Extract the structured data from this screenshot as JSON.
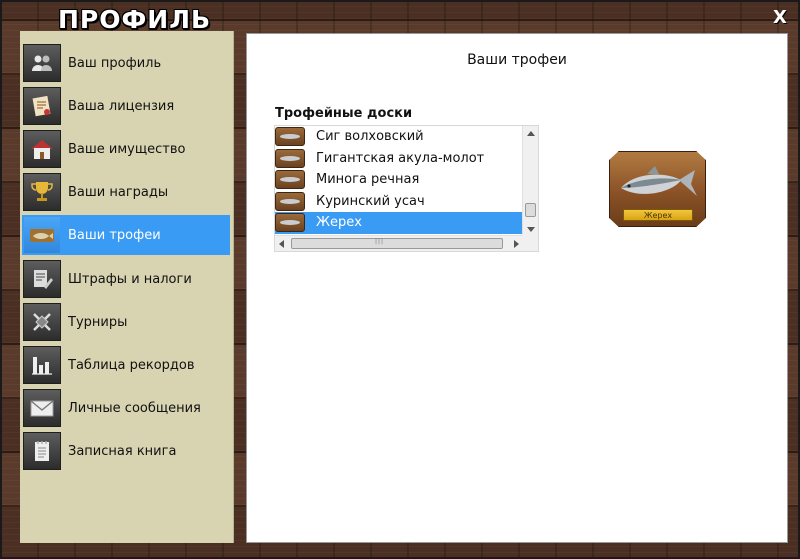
{
  "window": {
    "title": "ПРОФИЛЬ",
    "close_label": "X"
  },
  "sidebar": {
    "items": [
      {
        "label": "Ваш профиль",
        "icon": "users-icon",
        "active": false
      },
      {
        "label": "Ваша лицензия",
        "icon": "license-icon",
        "active": false
      },
      {
        "label": "Ваше имущество",
        "icon": "house-icon",
        "active": false
      },
      {
        "label": "Ваши награды",
        "icon": "trophy-cup-icon",
        "active": false
      },
      {
        "label": "Ваши трофеи",
        "icon": "fish-trophy-icon",
        "active": true
      },
      {
        "label": "Штрафы и налоги",
        "icon": "document-pen-icon",
        "active": false
      },
      {
        "label": "Турниры",
        "icon": "crossed-swords-icon",
        "active": false
      },
      {
        "label": "Таблица рекордов",
        "icon": "bar-chart-icon",
        "active": false
      },
      {
        "label": "Личные сообщения",
        "icon": "envelope-icon",
        "active": false
      },
      {
        "label": "Записная книга",
        "icon": "notebook-icon",
        "active": false
      }
    ]
  },
  "main": {
    "title": "Ваши трофеи",
    "section_label": "Трофейные доски",
    "trophy_list": [
      {
        "name": "Сиг волховский",
        "selected": false
      },
      {
        "name": "Гигантская акула-молот",
        "selected": false
      },
      {
        "name": "Минога речная",
        "selected": false
      },
      {
        "name": "Куринский усач",
        "selected": false
      },
      {
        "name": "Жерех",
        "selected": true
      }
    ],
    "preview": {
      "plaque_label": "Жерех"
    }
  },
  "colors": {
    "accent": "#3a9bf5",
    "sidebar_bg": "#d8d4b1",
    "wood_dark": "#3a241a",
    "plaque_gold": "#f2c53d"
  }
}
